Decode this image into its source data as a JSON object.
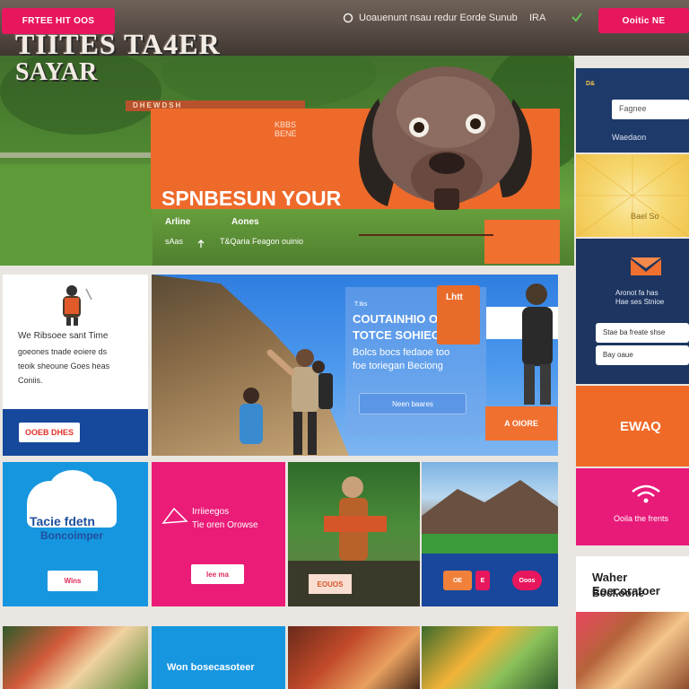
{
  "topbar": {
    "left_button": "FRTEE HIT OOS",
    "nav_text": "Uoauenunt nsau redur Eorde Sunub",
    "nav_extra": "IRA",
    "check_icon": "checkmark-icon",
    "right_button": "Ooitic NE"
  },
  "hero": {
    "title_line1": "TIITES TA4ER",
    "title_line2": "SAYAR",
    "strip": "DHEWDSH",
    "small_1": "KBBS",
    "small_2": "BENE",
    "headline": "SPNBESUN YOUR",
    "sub_a": "Arline",
    "sub_b": "Aones",
    "sub_c": "sAas",
    "sub_d": "T&Qaria Feagon ouinio"
  },
  "sidebar": {
    "logo_chip": "D&",
    "input_value": "Fagnee",
    "navy_text": "Waedaon",
    "yellow_text": "Bael So",
    "block_line1": "Aronot fa has",
    "block_line2": "Hae ses Stnioe",
    "input_a": "Stae ba freate shse",
    "input_b": "Bay oaue",
    "orange_text": "EWAQ",
    "pink_text": "Ooila the frents",
    "white_title": "Waher Eoecoratoer",
    "white_sub": "Bocl.oone"
  },
  "card": {
    "lines": [
      "We Ribsoee sant Time",
      "goeones tnade eoiere ds",
      "teoik sheoune Goes heas",
      "Coniis."
    ],
    "button": "OOEB DHES"
  },
  "feature": {
    "tag": "T.tks",
    "line1": "COUTAINHIO OOS",
    "line2": "TOTCE SOHIEOS",
    "line3": "Bolcs bocs fedaoe too",
    "line4": "foe toriegan Beciong",
    "button": "Neen baares",
    "orange_tag_text": "Lhtt",
    "action_button": "A OIORE"
  },
  "tiles": {
    "blue_title": "Tacie fdetn",
    "blue_sub": "Boncoimper",
    "blue_button": "Wins",
    "pink_line1": "Irriieegos",
    "pink_line2": "Tie oren Orowse",
    "pink_button": "Iee ma",
    "photo1_button": "EOUOS",
    "navy_chips": [
      "OE",
      "E",
      "Ooos"
    ]
  },
  "row3": {
    "blue_text": "Won bosecasoteer"
  },
  "colors": {
    "accent_pink": "#e8175d",
    "accent_orange": "#ee6a2b",
    "brand_navy": "#1e3a6b",
    "brand_blue": "#1796e0"
  }
}
